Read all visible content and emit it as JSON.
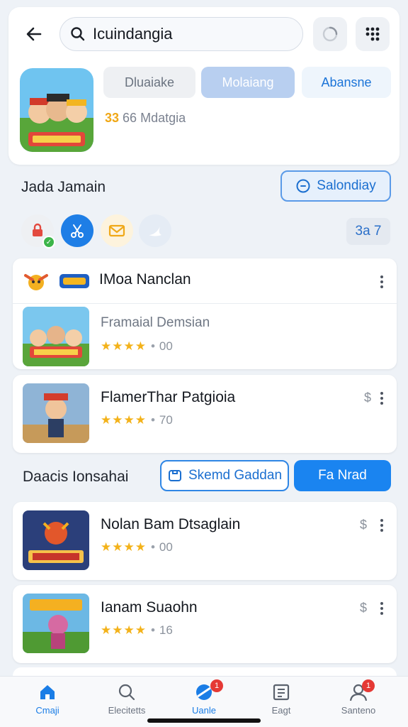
{
  "header": {
    "search_value": "Icuindangia",
    "icons": {
      "back": "back-arrow-icon",
      "search": "search-icon",
      "refresh": "refresh-icon",
      "grid": "grid-icon"
    }
  },
  "app": {
    "chips": [
      "Dluaiake",
      "Molaiang",
      "Abansne"
    ],
    "meta_num": "33",
    "meta_text": "66 Mdatgia"
  },
  "section1": {
    "title": "Jada Jamain",
    "button_label": "Salondiay",
    "count": "3a 7",
    "icons": [
      "lock-icon",
      "scissors-icon",
      "envelope-icon",
      "bird-icon"
    ]
  },
  "group": {
    "title": "IMoa Nanclan",
    "item": {
      "title": "Framaial Demsian",
      "stars": "★★★★",
      "dot": "•",
      "score": "00"
    }
  },
  "card2": {
    "title": "FlamerThar Patgioia",
    "stars": "★★★★",
    "dot": "•",
    "score": "70",
    "price": "$"
  },
  "section2": {
    "title": "Daacis Ionsahai",
    "outline_button": "Skemd Gaddan",
    "solid_button": "Fa Nrad"
  },
  "card3": {
    "title": "Nolan Bam Dtsaglain",
    "stars": "★★★★",
    "dot": "•",
    "score": "00",
    "price": "$"
  },
  "card4": {
    "title": "Ianam Suaohn",
    "stars": "★★★★",
    "dot": "•",
    "score": "16",
    "price": "$"
  },
  "bottom_nav": [
    {
      "label": "Cmaji",
      "icon": "home-icon",
      "active": true
    },
    {
      "label": "Elecitetts",
      "icon": "search-icon",
      "active": false
    },
    {
      "label": "Uanle",
      "icon": "games-icon",
      "badge": "1",
      "active": true
    },
    {
      "label": "Eagt",
      "icon": "apps-icon",
      "active": false
    },
    {
      "label": "Santeno",
      "icon": "profile-icon",
      "badge": "1",
      "active": false
    }
  ],
  "colors": {
    "accent": "#1a84f0",
    "star": "#f3b21a",
    "badge": "#e53935"
  }
}
